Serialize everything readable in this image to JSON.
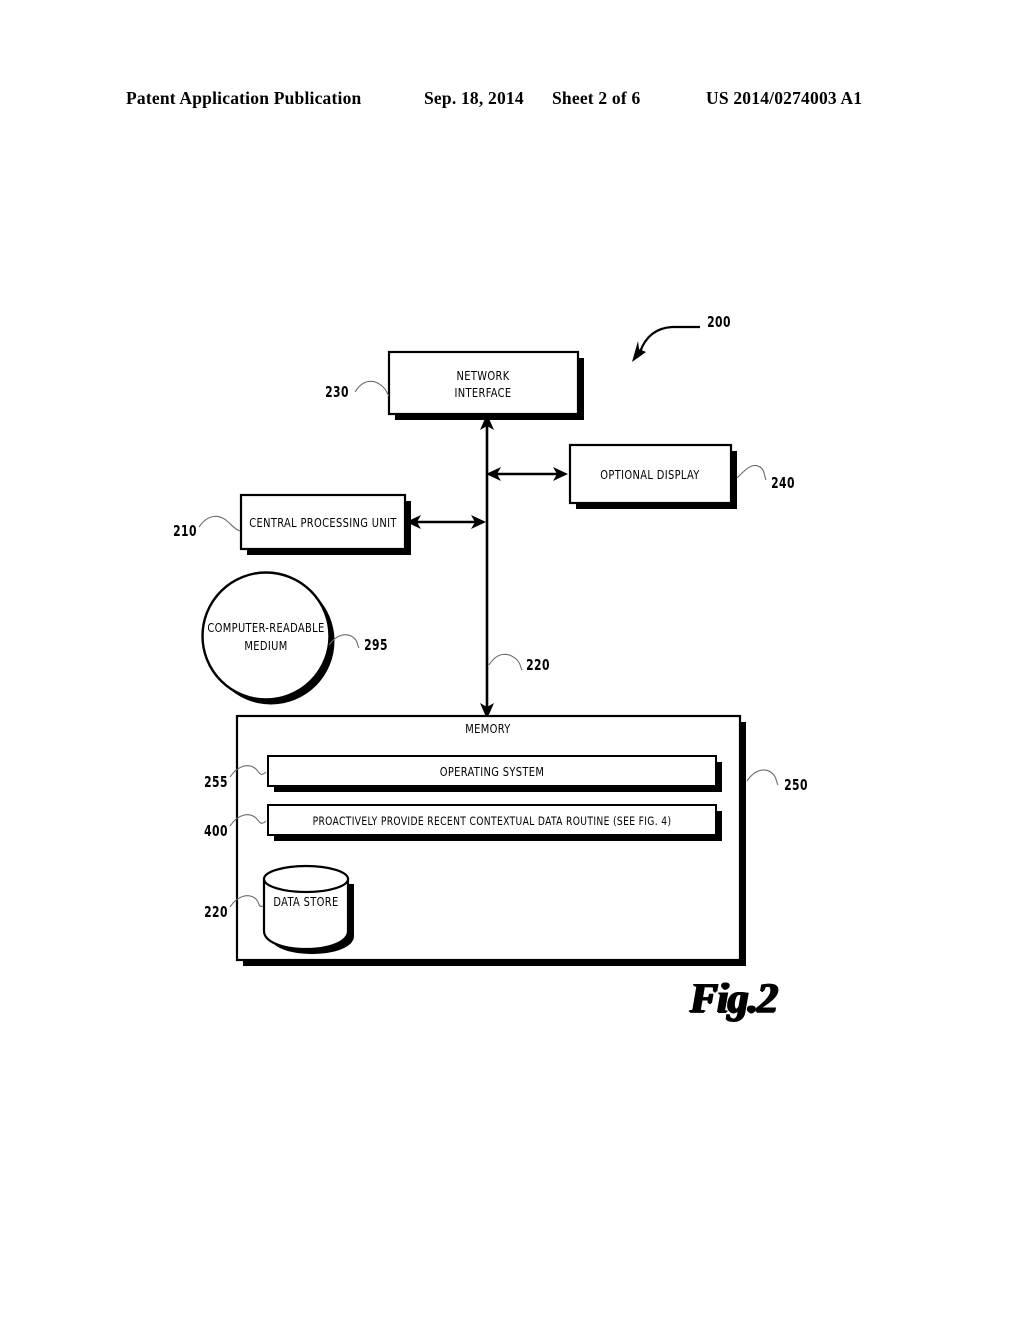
{
  "header": {
    "publication": "Patent Application Publication",
    "date": "Sep. 18, 2014",
    "sheet": "Sheet 2 of 6",
    "patent_number": "US 2014/0274003 A1"
  },
  "figure": {
    "caption": "Fig.2",
    "system_ref": "200",
    "blocks": {
      "network_interface": {
        "label_line1": "NETWORK",
        "label_line2": "INTERFACE",
        "ref": "230"
      },
      "optional_display": {
        "label": "OPTIONAL DISPLAY",
        "ref": "240"
      },
      "central_processing_unit": {
        "label": "CENTRAL PROCESSING UNIT",
        "ref": "210"
      },
      "computer_readable_medium": {
        "label_line1": "COMPUTER-READABLE",
        "label_line2": "MEDIUM",
        "ref": "295"
      },
      "system_bus": {
        "ref": "220"
      },
      "memory": {
        "label": "MEMORY",
        "ref": "250",
        "items": [
          {
            "label": "OPERATING SYSTEM",
            "ref": "255"
          },
          {
            "label": "PROACTIVELY PROVIDE RECENT CONTEXTUAL DATA ROUTINE (SEE FIG. 4)",
            "ref": "400"
          },
          {
            "label": "DATA STORE",
            "ref": "220"
          }
        ]
      }
    }
  }
}
